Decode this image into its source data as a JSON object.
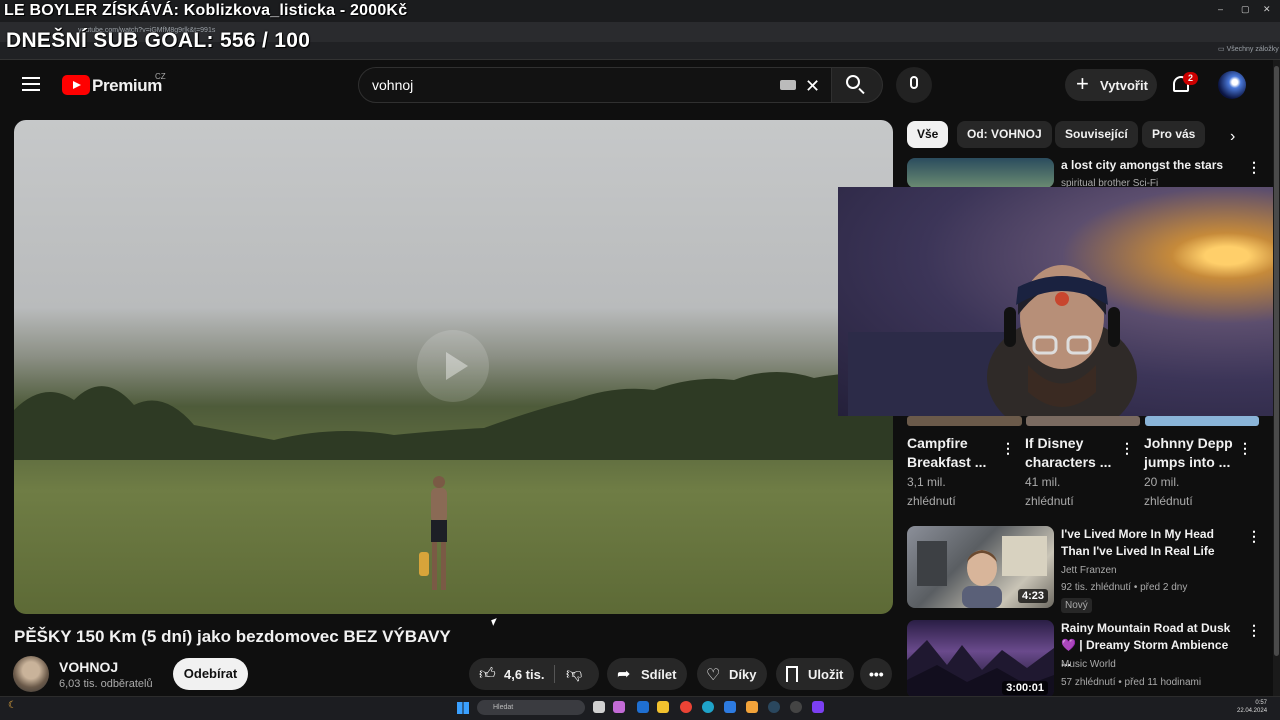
{
  "browser": {
    "url": "youtube.com/watch?v=iGMfM8g9rlk&t=991s",
    "bookmarks_label": "Všechny záložky",
    "window_controls": [
      "–",
      "▢",
      "✕"
    ]
  },
  "overlay": {
    "donation_text": "LE BOYLER ZÍSKÁVÁ: Koblizkova_listicka - 2000Kč",
    "sub_goal_text": "DNEŠNÍ SUB GOAL: 556 / 100"
  },
  "masthead": {
    "brand": "Premium",
    "country": "CZ",
    "search_value": "vohnoj",
    "create_label": "Vytvořit",
    "notification_count": "2"
  },
  "video": {
    "title": "PĚŠKY 150 Km (5 dní) jako bezdomovec BEZ VÝBAVY",
    "channel": "VOHNOJ",
    "subscribers": "6,03 tis. odběratelů",
    "subscribe_label": "Odebírat",
    "likes": "4,6 tis.",
    "share_label": "Sdílet",
    "thanks_label": "Díky",
    "save_label": "Uložit"
  },
  "chips": [
    "Vše",
    "Od: VOHNOJ",
    "Související",
    "Pro vás"
  ],
  "recommendations": {
    "rec1": {
      "title": "a lost city amongst the stars",
      "channel": "spiritual brother Sci-Fi"
    },
    "shorts": [
      {
        "title_line1": "Campfire",
        "title_line2": "Breakfast ...",
        "views_line1": "3,1 mil.",
        "views_line2": "zhlédnutí"
      },
      {
        "title_line1": "If Disney",
        "title_line2": "characters ...",
        "views_line1": "41 mil.",
        "views_line2": "zhlédnutí"
      },
      {
        "title_line1": "Johnny Depp",
        "title_line2": "jumps into ...",
        "views_line1": "20 mil.",
        "views_line2": "zhlédnutí"
      }
    ],
    "rec2": {
      "title_line1": "I've Lived More In My Head",
      "title_line2": "Than I've Lived In Real Life",
      "channel": "Jett Franzen",
      "meta": "92 tis. zhlédnutí • před 2 dny",
      "badge": "Nový",
      "duration": "4:23"
    },
    "rec3": {
      "title_line1": "Rainy Mountain Road at Dusk",
      "title_line2": "💜 | Dreamy Storm Ambience ...",
      "channel": "Music World",
      "meta": "57 zhlédnutí • před 11 hodinami",
      "duration": "3:00:01"
    }
  },
  "taskbar": {
    "search_placeholder": "Hledat",
    "time": "0:57",
    "date": "22.04.2024"
  },
  "colors": {
    "background": "#0f0f0f",
    "brand_red": "#ff0000",
    "chip_active_bg": "#f1f1f1"
  }
}
